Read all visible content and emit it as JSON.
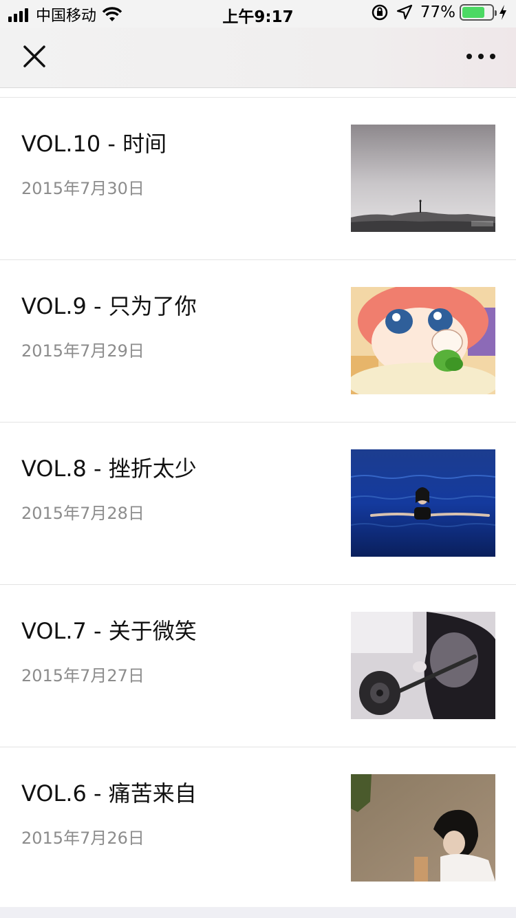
{
  "status_bar": {
    "carrier": "中国移动",
    "time": "上午9:17",
    "battery_percent": "77%",
    "battery_level": 0.77,
    "icons": [
      "signal-icon",
      "wifi-icon",
      "orientation-lock-icon",
      "location-icon",
      "battery-icon",
      "charging-icon"
    ]
  },
  "nav": {
    "close_icon": "close-icon",
    "more_icon": "more-icon"
  },
  "articles": [
    {
      "title": "VOL.10 - 时间",
      "date": "2015年7月30日",
      "thumbnail": "misty-landscape"
    },
    {
      "title": "VOL.9 - 只为了你",
      "date": "2015年7月29日",
      "thumbnail": "anime-girl"
    },
    {
      "title": "VOL.8 - 挫折太少",
      "date": "2015年7月28日",
      "thumbnail": "woman-in-water"
    },
    {
      "title": "VOL.7 - 关于微笑",
      "date": "2015年7月27日",
      "thumbnail": "barbell-girl"
    },
    {
      "title": "VOL.6 - 痛苦来自",
      "date": "2015年7月26日",
      "thumbnail": "girl-portrait"
    }
  ]
}
